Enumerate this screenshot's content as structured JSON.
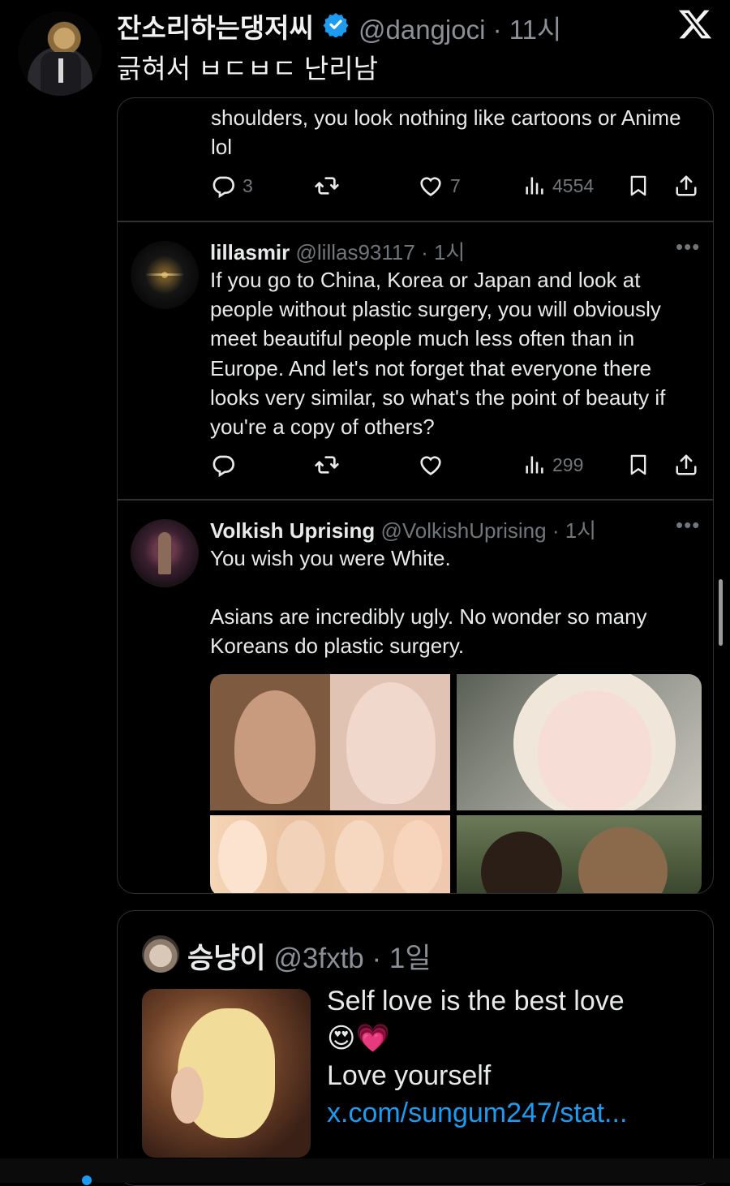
{
  "outer_tweet": {
    "author_name": "잔소리하는댕저씨",
    "handle_time": "@dangjoci · 11시",
    "text": "긁혀서 ㅂㄷㅂㄷ 난리남"
  },
  "thread": {
    "top_reply": {
      "text": "shoulders, you look nothing like cartoons or Anime lol",
      "replies": "3",
      "likes": "7",
      "views": "4554"
    },
    "reply_lillasmir": {
      "name": "lillasmir",
      "handle_time": "@lillas93117 · 1시",
      "more": "•••",
      "text": "If you go to China, Korea or Japan and look at people without plastic surgery, you will obviously meet beautiful people much less often than in Europe. And let's not forget that everyone there looks very similar, so what's the point of beauty if you're a copy of others?",
      "views": "299"
    },
    "reply_volkish": {
      "name": "Volkish Uprising",
      "handle_time": "@VolkishUprising · 1시",
      "more": "•••",
      "text_line1": "You wish you were White.",
      "text_line2": "Asians are incredibly ugly. No wonder so many Koreans do plastic surgery."
    }
  },
  "quote2": {
    "name": "승냥이",
    "handle_time": "@3fxtb · 1일",
    "text_line1": "Self love is the best love",
    "emoji": "😍💗",
    "text_line3": "Love yourself ",
    "link": "x.com/sungum247/stat..."
  },
  "colors": {
    "background": "#000000",
    "text": "#e7e9ea",
    "muted": "#71767b",
    "link": "#1d9bf0",
    "border": "#2f3336"
  },
  "icons": [
    "verified-badge-icon",
    "x-logo-icon",
    "reply-icon",
    "retweet-icon",
    "like-icon",
    "views-icon",
    "bookmark-icon",
    "share-icon",
    "more-icon"
  ]
}
